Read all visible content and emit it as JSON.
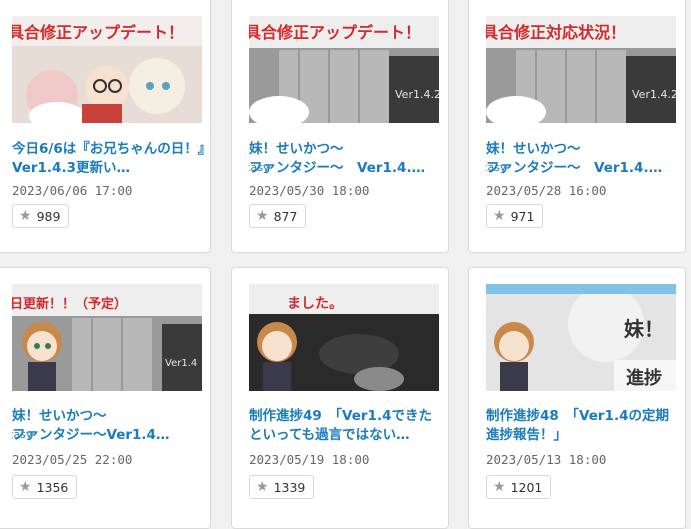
{
  "cards": [
    {
      "title": "今日6/6は『お兄ちゃんの日！』　Ver1.4.3更新い…",
      "date": "2023/06/06 17:00",
      "likes": "989",
      "banner": "具合修正アップデート！",
      "ver": "Ver1.4.3"
    },
    {
      "title_a": "妹！せいかつ～",
      "ruby": "fantasy",
      "title_b": "ファンタジー～　Ver1.4.…",
      "date": "2023/05/30 18:00",
      "likes": "877",
      "banner": "具合修正アップデート！",
      "ver": "Ver1.4.2"
    },
    {
      "title_a": "妹！せいかつ～",
      "ruby": "fantasy",
      "title_b": "ファンタジー～　Ver1.4.…",
      "date": "2023/05/28 16:00",
      "likes": "971",
      "banner": "具合修正対応状況！",
      "ver": "Ver1.4.2"
    },
    {
      "title_a": "妹！せいかつ～",
      "ruby": "fantasy",
      "title_b": "ファンタジー～Ver1.4…",
      "date": "2023/05/25 22:00",
      "likes": "1356",
      "banner": "日更新！！（予定）",
      "ver": "Ver1.4"
    },
    {
      "title": "制作進捗49　「Ver1.4できたといっても過言ではない…",
      "date": "2023/05/19 18:00",
      "likes": "1339",
      "banner": "ました。",
      "ver": "Ver1.4"
    },
    {
      "title": "制作進捗48　「Ver1.4の定期進捗報告！」",
      "date": "2023/05/13 18:00",
      "likes": "1201",
      "banner": "妹！",
      "ver": "進捗"
    }
  ],
  "colors": {
    "link": "#1a7bbf",
    "banner_red": "#d42a2a"
  },
  "icons": {
    "like": "star-icon"
  }
}
